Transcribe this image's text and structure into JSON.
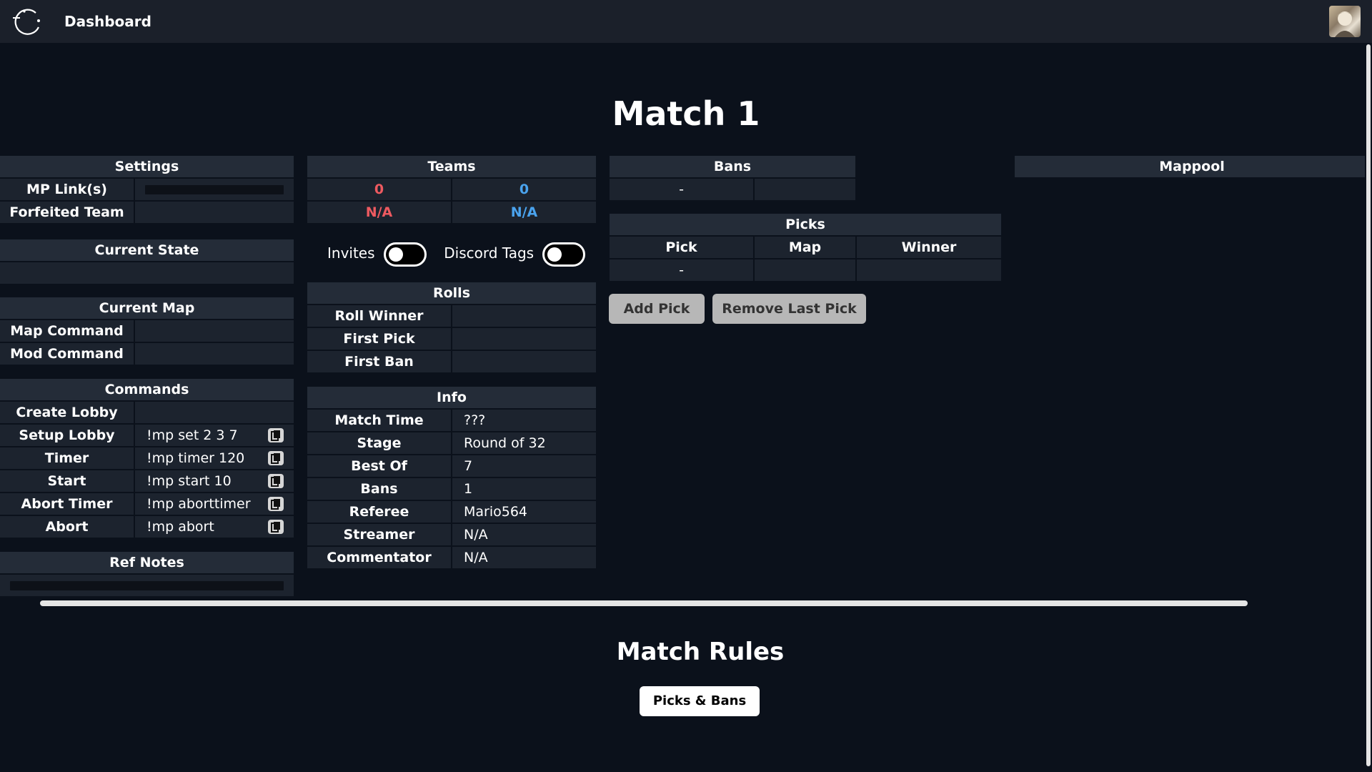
{
  "topbar": {
    "nav_label": "Dashboard"
  },
  "page": {
    "title": "Match 1"
  },
  "settings": {
    "header": "Settings",
    "mp_links_label": "MP Link(s)",
    "forfeited_label": "Forfeited Team"
  },
  "current_state": {
    "header": "Current State"
  },
  "current_map": {
    "header": "Current Map",
    "map_command_label": "Map Command",
    "mod_command_label": "Mod Command"
  },
  "commands": {
    "header": "Commands",
    "items": [
      {
        "label": "Create Lobby",
        "value": ""
      },
      {
        "label": "Setup Lobby",
        "value": "!mp set 2 3 7"
      },
      {
        "label": "Timer",
        "value": "!mp timer 120"
      },
      {
        "label": "Start",
        "value": "!mp start 10"
      },
      {
        "label": "Abort Timer",
        "value": "!mp aborttimer"
      },
      {
        "label": "Abort",
        "value": "!mp abort"
      }
    ]
  },
  "ref_notes": {
    "header": "Ref Notes"
  },
  "teams": {
    "header": "Teams",
    "red_score": "0",
    "blue_score": "0",
    "red_name": "N/A",
    "blue_name": "N/A"
  },
  "toggles": {
    "invites_label": "Invites",
    "discord_label": "Discord Tags"
  },
  "rolls": {
    "header": "Rolls",
    "roll_winner_label": "Roll Winner",
    "first_pick_label": "First Pick",
    "first_ban_label": "First Ban"
  },
  "info": {
    "header": "Info",
    "rows": [
      {
        "label": "Match Time",
        "value": "???"
      },
      {
        "label": "Stage",
        "value": "Round of 32"
      },
      {
        "label": "Best Of",
        "value": "7"
      },
      {
        "label": "Bans",
        "value": "1"
      },
      {
        "label": "Referee",
        "value": "Mario564"
      },
      {
        "label": "Streamer",
        "value": "N/A"
      },
      {
        "label": "Commentator",
        "value": "N/A"
      }
    ]
  },
  "bans": {
    "header": "Bans",
    "placeholder": "-"
  },
  "picks": {
    "header": "Picks",
    "columns": [
      "Pick",
      "Map",
      "Winner"
    ],
    "placeholder": "-"
  },
  "actions": {
    "add_pick": "Add Pick",
    "remove_last_pick": "Remove Last Pick"
  },
  "mappool": {
    "header": "Mappool"
  },
  "rules": {
    "title": "Match Rules",
    "button": "Picks & Bans"
  },
  "colors": {
    "bg": "#0b111b",
    "header": "#242c38",
    "cell": "#1c232e",
    "red": "#ee5a60",
    "blue": "#4aa3ee"
  }
}
